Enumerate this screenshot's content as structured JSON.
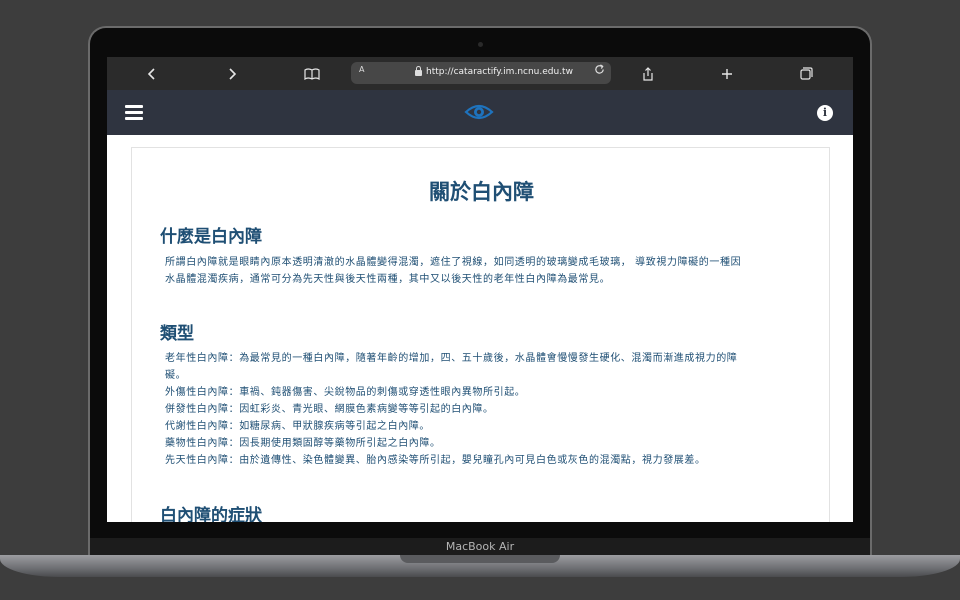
{
  "device": {
    "brand_label": "MacBook Air"
  },
  "browser": {
    "url": "http://cataractify.im.ncnu.edu.tw",
    "text_size_label": "A",
    "icons": [
      "back-icon",
      "forward-icon",
      "book-icon",
      "text-size-icon",
      "lock-icon",
      "reload-icon",
      "share-icon",
      "new-tab-icon",
      "tabs-icon"
    ]
  },
  "app": {
    "header_bg": "#2f3440",
    "accent": "#1f4f74",
    "logo_color": "#1e73be",
    "icons": [
      "hamburger-icon",
      "eye-logo-icon",
      "info-icon"
    ],
    "info_glyph": "i"
  },
  "article": {
    "title": "關於白內障",
    "sections": [
      {
        "heading": "什麼是白內障",
        "lines": [
          "所謂白內障就是眼睛內原本透明清澈的水晶體變得混濁，遮住了視線，如同透明的玻璃變成毛玻璃， 導致視力障礙的一種因",
          "水晶體混濁疾病，通常可分為先天性與後天性兩種，其中又以後天性的老年性白內障為最常見。"
        ]
      },
      {
        "heading": "類型",
        "lines": [
          "老年性白內障：為最常見的一種白內障，隨著年齡的增加，四、五十歲後，水晶體會慢慢發生硬化、混濁而漸進成視力的障",
          "礙。",
          "外傷性白內障：車禍、鈍器傷害、尖銳物品的刺傷或穿透性眼內異物所引起。",
          "併發性白內障：因虹彩炎、青光眼、網膜色素病變等等引起的白內障。",
          "代謝性白內障：如糖尿病、甲狀腺疾病等引起之白內障。",
          "藥物性白內障：因長期使用類固醇等藥物所引起之白內障。",
          "先天性白內障：由於遺傳性、染色體變異、胎內感染等所引起，嬰兒瞳孔內可見白色或灰色的混濁點，視力發展差。"
        ]
      },
      {
        "heading": "白內障的症狀",
        "lines": []
      }
    ]
  }
}
